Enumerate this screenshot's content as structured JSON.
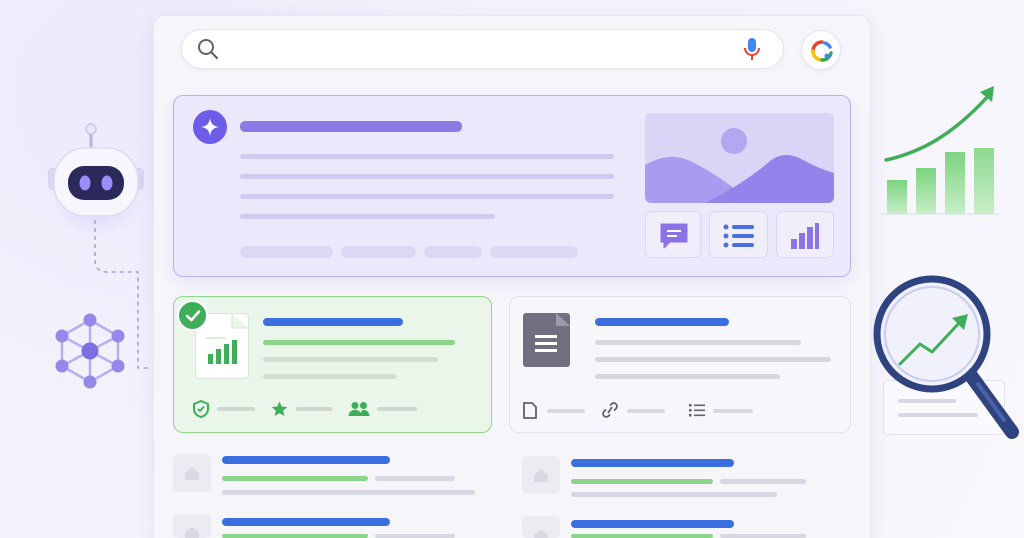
{
  "colors": {
    "accent": "#6c5ce7",
    "brand_blue": "#3b6fe0",
    "success_green": "#3fae58",
    "placeholder_gray": "#dcdce6",
    "lavender": "#b9b0f0"
  },
  "search": {
    "placeholder": ""
  },
  "icons": [
    "search-icon",
    "mic-icon",
    "lens-icon",
    "sparkle-icon",
    "landscape-image-icon",
    "chat-icon",
    "list-icon",
    "bar-chart-icon",
    "check-icon",
    "spreadsheet-icon",
    "shield-icon",
    "star-icon",
    "people-icon",
    "document-icon",
    "file-icon",
    "link-icon",
    "bullet-list-icon",
    "robot-icon",
    "network-graph-icon",
    "growth-chart-icon",
    "magnifier-trend-icon",
    "home-icon"
  ]
}
